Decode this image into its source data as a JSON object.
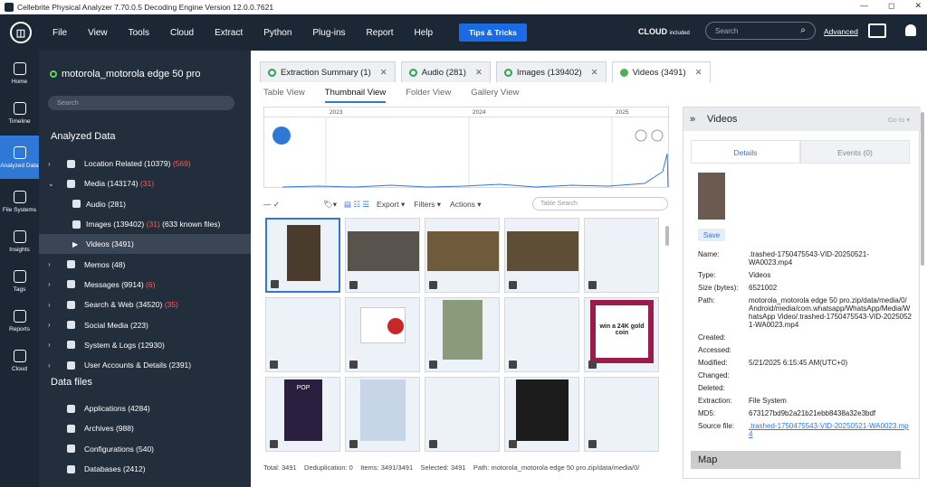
{
  "window": {
    "title": "Cellebrite Physical Analyzer 7.70.0.5  Decoding Engine Version 12.0.0.7621",
    "min": "—",
    "max": "◻",
    "close": "✕"
  },
  "menubar": {
    "items": [
      "File",
      "View",
      "Tools",
      "Cloud",
      "Extract",
      "Python",
      "Plug-ins",
      "Report",
      "Help"
    ],
    "tips": "Tips & Tricks",
    "cloud": "CLOUD",
    "cloud_sub": "included",
    "search_placeholder": "Search",
    "advanced": "Advanced"
  },
  "leftnav": [
    "Home",
    "Timeline",
    "Analyzed Data",
    "File Systems",
    "Insights",
    "Tags",
    "Reports",
    "Cloud"
  ],
  "sidebar": {
    "device": "motorola_motorola edge 50 pro",
    "search_placeholder": "Search",
    "analyzed_title": "Analyzed Data",
    "items": [
      {
        "label": "Location Related (10379)",
        "extra": "(569)"
      },
      {
        "label": "Media (143174)",
        "extra": "(31)"
      },
      {
        "label": "Audio (281)",
        "extra": ""
      },
      {
        "label": "Images (139402)",
        "extra": "(31)",
        "tail": "(633 known files)"
      },
      {
        "label": "Videos (3491)",
        "extra": ""
      },
      {
        "label": "Memos (48)",
        "extra": ""
      },
      {
        "label": "Messages (9914)",
        "extra": "(6)"
      },
      {
        "label": "Search & Web (34520)",
        "extra": "(35)"
      },
      {
        "label": "Social Media (223)",
        "extra": ""
      },
      {
        "label": "System & Logs (12930)",
        "extra": ""
      },
      {
        "label": "User Accounts & Details (2391)",
        "extra": ""
      }
    ],
    "datafiles_title": "Data files",
    "datafiles": [
      "Applications (4284)",
      "Archives (988)",
      "Configurations (540)",
      "Databases (2412)"
    ]
  },
  "tabs": [
    {
      "label": "Extraction Summary (1)"
    },
    {
      "label": "Audio (281)"
    },
    {
      "label": "Images (139402)"
    },
    {
      "label": "Videos (3491)"
    }
  ],
  "subtabs": [
    "Table View",
    "Thumbnail View",
    "Folder View",
    "Gallery View"
  ],
  "timeline": {
    "years": [
      "2023",
      "2024",
      "2025"
    ]
  },
  "toolbar": {
    "export": "Export",
    "filters": "Filters",
    "actions": "Actions",
    "search_placeholder": "Table Search"
  },
  "thumbs": {
    "coin_text": "win a 24K gold coin",
    "pop_text": "POP"
  },
  "status": {
    "total": "Total: 3491",
    "dedup": "Deduplication: 0",
    "items": "Items: 3491/3491",
    "selected": "Selected: 3491",
    "path": "Path: motorola_motorola edge 50 pro.zip/data/media/0/"
  },
  "detail": {
    "title": "Videos",
    "goto": "Go to",
    "tab_details": "Details",
    "tab_events": "Events (0)",
    "save": "Save",
    "props": [
      {
        "k": "Name:",
        "v": ".trashed-1750475543-VID-20250521-WA0023.mp4"
      },
      {
        "k": "Type:",
        "v": "Videos"
      },
      {
        "k": "Size (bytes):",
        "v": "6521002"
      },
      {
        "k": "Path:",
        "v": "motorola_motorola edge 50 pro.zip/data/media/0/Android/media/com.whatsapp/WhatsApp/Media/WhatsApp Video/.trashed-1750475543-VID-20250521-WA0023.mp4"
      },
      {
        "k": "Created:",
        "v": ""
      },
      {
        "k": "Accessed:",
        "v": ""
      },
      {
        "k": "Modified:",
        "v": "5/21/2025 6:15:45 AM(UTC+0)"
      },
      {
        "k": "Changed:",
        "v": ""
      },
      {
        "k": "Deleted:",
        "v": ""
      },
      {
        "k": "Extraction:",
        "v": "File System"
      },
      {
        "k": "MD5:",
        "v": "673127bd9b2a21b21ebb8438a32e3bdf"
      },
      {
        "k": "Source file:",
        "v": ".trashed-1750475543-VID-20250521-WA0023.mp4"
      }
    ],
    "map": "Map"
  }
}
